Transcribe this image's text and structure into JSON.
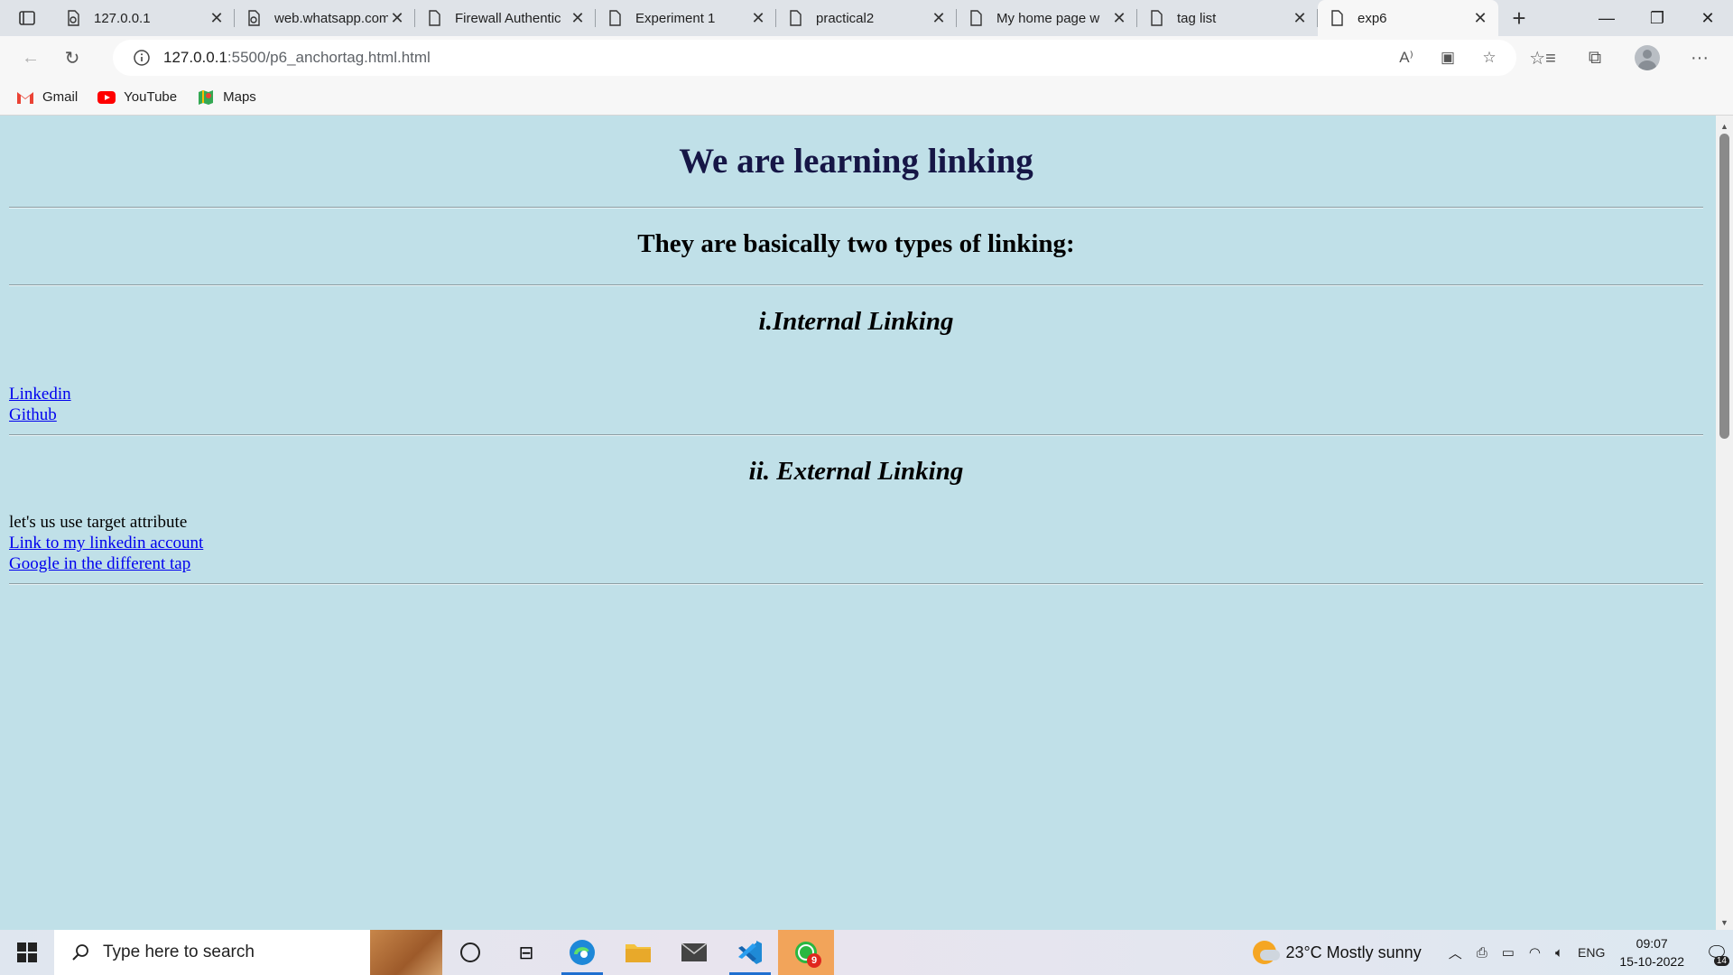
{
  "browser": {
    "tabs": [
      {
        "title": "127.0.0.1",
        "icon": "page-loading-icon"
      },
      {
        "title": "web.whatsapp.com",
        "icon": "page-loading-icon"
      },
      {
        "title": "Firewall Authentic",
        "icon": "page-icon"
      },
      {
        "title": "Experiment 1",
        "icon": "page-icon"
      },
      {
        "title": "practical2",
        "icon": "page-icon"
      },
      {
        "title": "My home page w",
        "icon": "page-icon"
      },
      {
        "title": "tag list",
        "icon": "page-icon"
      },
      {
        "title": "exp6",
        "icon": "page-icon",
        "active": true
      }
    ],
    "address": {
      "host": "127.0.0.1",
      "path": ":5500/p6_anchortag.html.html"
    },
    "favorites": [
      {
        "label": "Gmail",
        "icon": "gmail-icon"
      },
      {
        "label": "YouTube",
        "icon": "youtube-icon"
      },
      {
        "label": "Maps",
        "icon": "maps-icon"
      }
    ]
  },
  "page": {
    "background": "#c0e0e8",
    "heading": "We are learning linking",
    "subheading": "They are basically two types of linking:",
    "internal_heading": "i.Internal Linking",
    "internal_links": [
      "Linkedin",
      "Github"
    ],
    "external_heading": "ii. External Linking",
    "external_text": "let's us use target attribute",
    "external_links": [
      "Link to my linkedin account",
      "Google in the different tap"
    ]
  },
  "taskbar": {
    "search_placeholder": "Type here to search",
    "whatsapp_badge": "9",
    "weather": "23°C  Mostly sunny",
    "language": "ENG",
    "time": "09:07",
    "date": "15-10-2022",
    "notifications": "14"
  }
}
